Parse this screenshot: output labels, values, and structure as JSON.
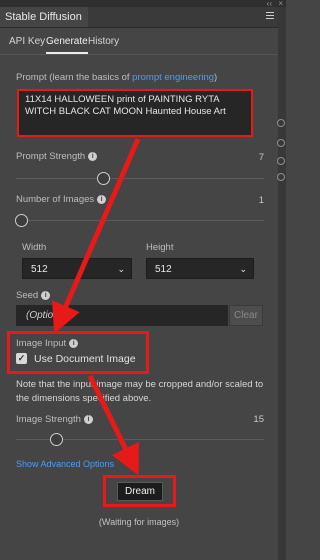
{
  "panel": {
    "title": "Stable Diffusion"
  },
  "tabs": [
    {
      "label": "API Key"
    },
    {
      "label": "Generate"
    },
    {
      "label": "History"
    }
  ],
  "prompt": {
    "label": "Prompt (learn the basics of ",
    "link_text": "prompt engineering",
    "label_suffix": ")",
    "value": "11X14 HALLOWEEN print of  PAINTING RYTA WITCH BLACK CAT MOON Haunted House Art"
  },
  "prompt_strength": {
    "label": "Prompt Strength",
    "value": "7",
    "slider_fraction": 0.35
  },
  "number_of_images": {
    "label": "Number of Images",
    "value": "1",
    "slider_fraction": 0.02
  },
  "width": {
    "label": "Width",
    "value": "512"
  },
  "height": {
    "label": "Height",
    "value": "512"
  },
  "seed": {
    "label": "Seed",
    "placeholder": "(Optional)",
    "clear_label": "Clear"
  },
  "image_input": {
    "label": "Image Input",
    "checkbox_label": "Use Document Image",
    "checked": true,
    "note": "Note that the input image may be cropped and/or scaled to the dimensions specified above."
  },
  "image_strength": {
    "label": "Image Strength",
    "value": "15",
    "slider_fraction": 0.16
  },
  "advanced": {
    "label": "Show Advanced Options"
  },
  "dream": {
    "label": "Dream"
  },
  "status": {
    "text": "(Waiting for images)"
  },
  "colors": {
    "background": "#454545",
    "field": "#262626",
    "link": "#4a9ef5",
    "annotation": "#e81919"
  }
}
